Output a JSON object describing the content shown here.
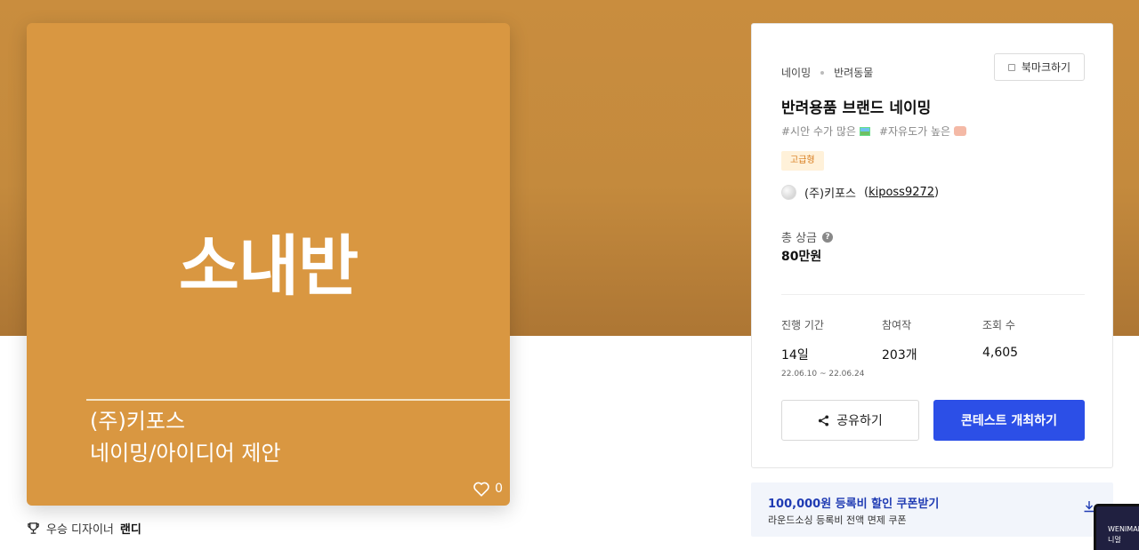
{
  "thumbnail": {
    "title": "소내반",
    "subtitle_line1": "(주)키포스",
    "subtitle_line2": "네이밍/아이디어 제안",
    "like_count": "0"
  },
  "designer": {
    "prefix": "우승 디자이너",
    "name": "랜디"
  },
  "info": {
    "breadcrumb": [
      "네이밍",
      "반려동물"
    ],
    "bookmark_label": "북마크하기",
    "title": "반려용품 브랜드 네이밍",
    "tags": [
      "#시안 수가 많은",
      "#자유도가 높은"
    ],
    "badge": "고급형",
    "company_name": "(주)키포스",
    "company_id": "kiposs9272",
    "prize_label": "총 상금",
    "prize_help": "?",
    "prize_value": "80만원",
    "stats": {
      "duration_label": "진행 기간",
      "duration_value": "14일",
      "duration_range": "22.06.10 ~ 22.06.24",
      "entries_label": "참여작",
      "entries_value": "203개",
      "views_label": "조회 수",
      "views_value": "4,605"
    },
    "share_label": "공유하기",
    "host_label": "콘테스트 개최하기"
  },
  "coupon": {
    "title": "100,000원 등록비 할인 쿠폰받기",
    "desc": "라운드소싱 등록비 전액 면제 쿠폰"
  },
  "mini": {
    "line1": "WENIMAL",
    "line2": "니멀"
  },
  "colors": {
    "hero": "#c98d3e",
    "thumb": "#d99741",
    "primary": "#2c4fe7",
    "badge_bg": "#fff1d9",
    "badge_text": "#d77b1c"
  }
}
